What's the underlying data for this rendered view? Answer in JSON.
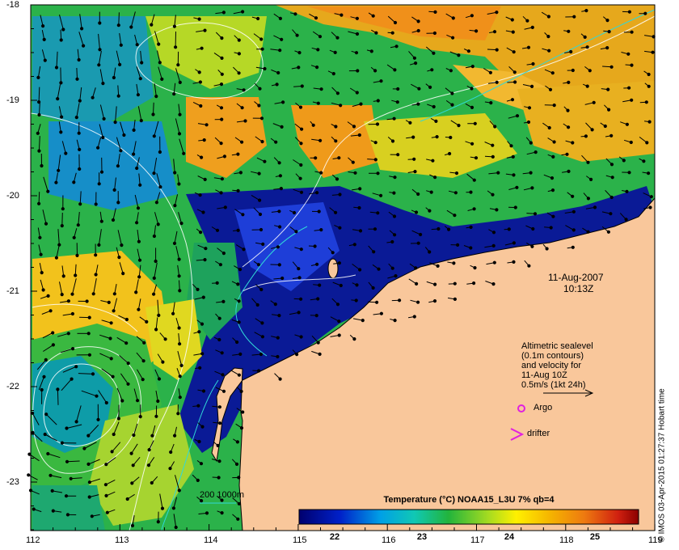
{
  "date": "11-Aug-2007",
  "time": "10:13Z",
  "legend": {
    "l1": "Altimetric sealevel",
    "l2": "(0.1m contours)",
    "l3": "and velocity for",
    "l4": "11-Aug 10Z",
    "l5": "0.5m/s (1kt 24h)",
    "argo": "Argo",
    "drifter": "drifter"
  },
  "colorbar": {
    "title": "Temperature (°C) NOAA15_L3U 7% qb=4",
    "ticks": [
      "22",
      "23",
      "24",
      "25"
    ]
  },
  "isobath": "200  1000m",
  "side_text": "© IMOS 03-Apr-2015 01:27:37 Hobart time",
  "lon_ticks": [
    "112",
    "113",
    "114",
    "115",
    "116",
    "117",
    "118",
    "119"
  ],
  "lat_ticks": [
    "-18",
    "-19",
    "-20",
    "-21",
    "-22",
    "-23"
  ],
  "colors": {
    "land": "#f9c79b",
    "cold": "#00108a",
    "mid": "#22b24c",
    "warm": "#f5b800",
    "hot": "#e86a10"
  }
}
